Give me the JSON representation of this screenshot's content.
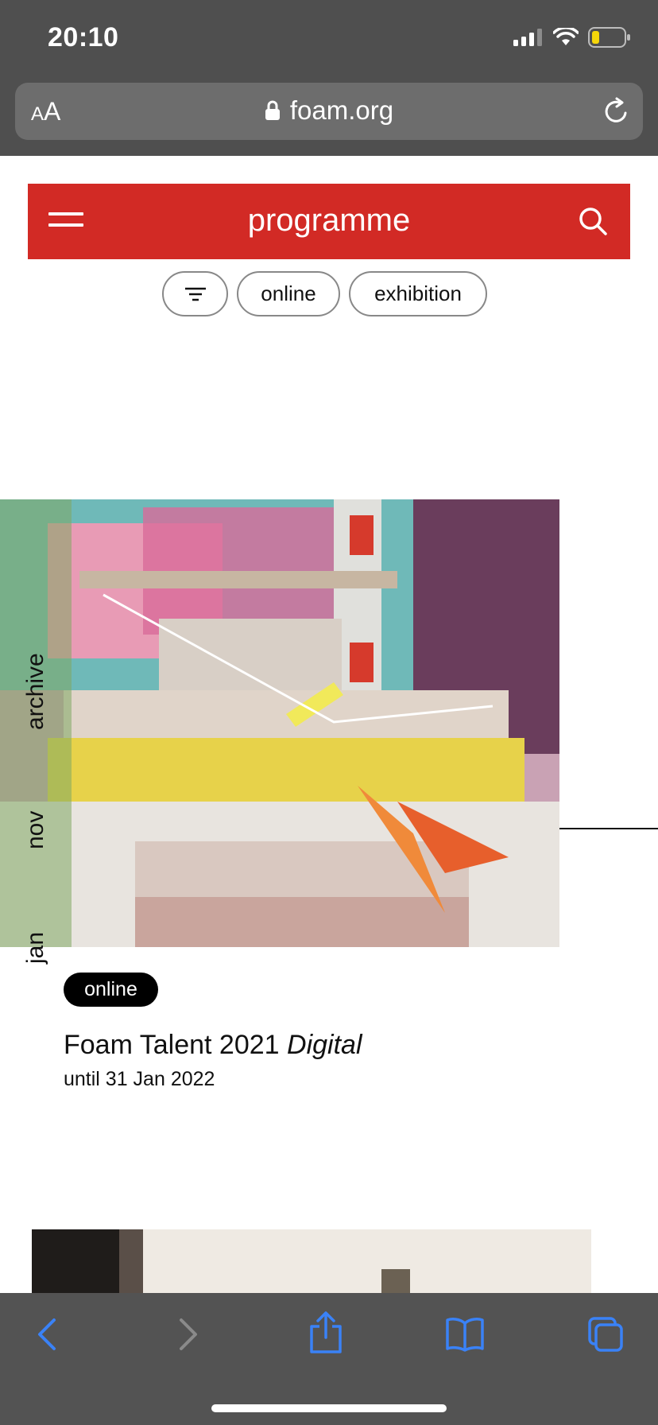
{
  "status_bar": {
    "time": "20:10"
  },
  "browser": {
    "text_size_label_small": "A",
    "text_size_label_large": "A",
    "url": "foam.org"
  },
  "site": {
    "title": "programme"
  },
  "filters": {
    "items": [
      {
        "label": "online"
      },
      {
        "label": "exhibition"
      }
    ]
  },
  "timeline": {
    "labels": [
      "jan",
      "nov",
      "archive"
    ]
  },
  "event": {
    "badge": "online",
    "title_main": "Foam Talent 2021",
    "title_italic": "Digital",
    "date": "until 31 Jan 2022"
  },
  "colors": {
    "brand_red": "#d22a25",
    "chrome_gray": "#4f4f4f",
    "toolbar_gray": "#535353",
    "ios_blue": "#3a82f7",
    "disabled_gray": "#8a8a8a"
  },
  "icons": {
    "menu": "hamburger-icon",
    "search": "search-icon",
    "filter": "filter-icon",
    "lock": "lock-icon",
    "reload": "reload-icon",
    "back": "back-icon",
    "forward": "forward-icon",
    "share": "share-icon",
    "bookmarks": "bookmarks-icon",
    "tabs": "tabs-icon"
  }
}
